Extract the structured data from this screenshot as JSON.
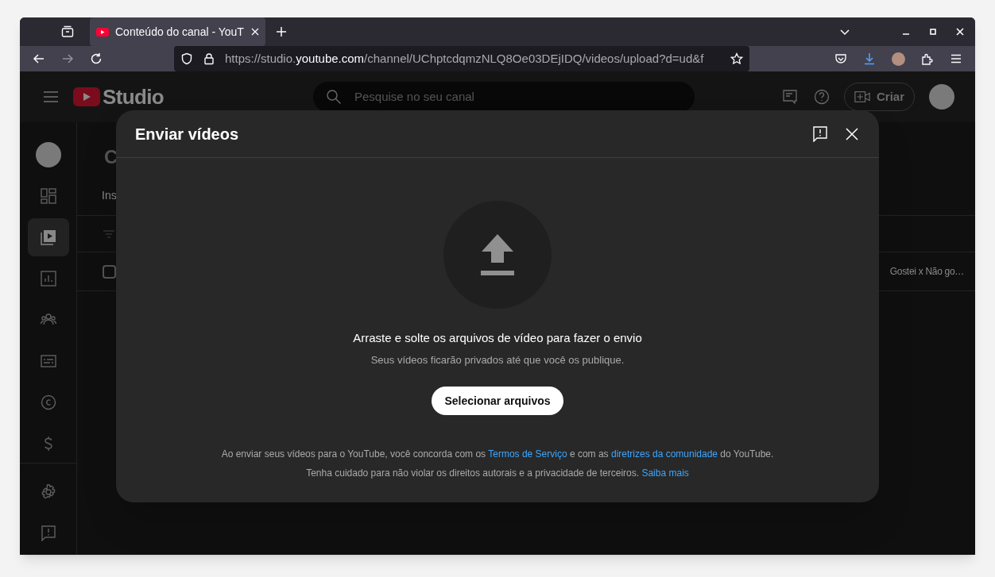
{
  "browser": {
    "tab": {
      "title": "Conteúdo do canal - YouT",
      "selected": true
    },
    "address": {
      "prefix": "https://studio.",
      "host": "youtube.com",
      "path": "/channel/UChptcdqmzNLQ8Oe03DEjIDQ/videos/upload?d=ud&f"
    }
  },
  "header": {
    "logo_text": "Studio",
    "search": {
      "placeholder": "Pesquise no seu canal"
    },
    "create_button": "Criar"
  },
  "sidebar": {
    "items": [
      {
        "kind": "avatar",
        "selected": false
      },
      {
        "kind": "dashboard",
        "selected": false
      },
      {
        "kind": "content",
        "selected": true
      },
      {
        "kind": "analytics",
        "selected": false
      },
      {
        "kind": "audience",
        "selected": false
      },
      {
        "kind": "subtitles",
        "selected": false
      },
      {
        "kind": "copyright",
        "selected": false
      },
      {
        "kind": "earn",
        "selected": false
      }
    ],
    "bottom_items": [
      {
        "kind": "settings",
        "selected": false
      },
      {
        "kind": "feedback",
        "selected": false
      }
    ]
  },
  "background": {
    "heading": "C",
    "tab": "Ins",
    "row_cell": "Gostei x Não go…",
    "row_checked": false
  },
  "dialog": {
    "title": "Enviar vídeos",
    "drop_title": "Arraste e solte os arquivos de vídeo para fazer o envio",
    "drop_subtitle": "Seus vídeos ficarão privados até que você os publique.",
    "select_button": "Selecionar arquivos",
    "terms": [
      [
        {
          "text": "Ao enviar seus vídeos para o YouTube, você concorda com os ",
          "link": false
        },
        {
          "text": "Termos de Serviço",
          "link": true
        },
        {
          "text": " e com as ",
          "link": false
        },
        {
          "text": "diretrizes da comunidade",
          "link": true
        },
        {
          "text": " do YouTube.",
          "link": false
        }
      ],
      [
        {
          "text": "Tenha cuidado para não violar os direitos autorais e a privacidade de terceiros. ",
          "link": false
        },
        {
          "text": "Saiba mais",
          "link": true
        }
      ]
    ]
  }
}
